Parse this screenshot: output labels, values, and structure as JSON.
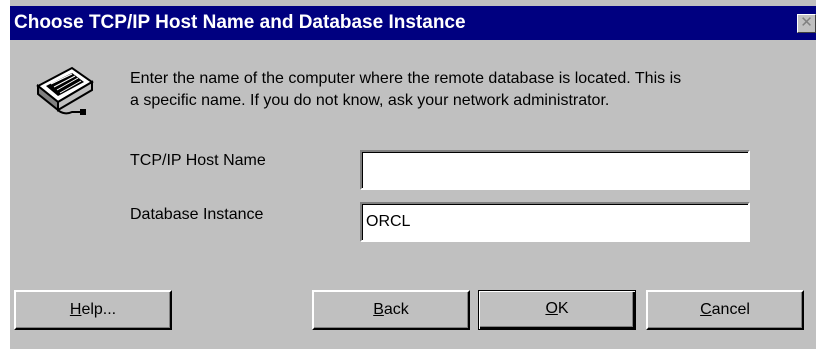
{
  "dialog": {
    "title": "Choose TCP/IP Host Name and Database Instance",
    "close_symbol": "✕",
    "icon": "network-computer-icon",
    "description_line1": "Enter the name of the computer where the remote database is located.  This is",
    "description_line2": "a specific name.  If you do not know, ask your network administrator."
  },
  "form": {
    "host_label": "TCP/IP Host Name",
    "host_value": "",
    "instance_label": "Database Instance",
    "instance_value": "ORCL"
  },
  "buttons": {
    "help": {
      "mnemonic": "H",
      "rest": "elp..."
    },
    "back": {
      "mnemonic": "B",
      "rest": "ack"
    },
    "ok": {
      "mnemonic": "O",
      "rest": "K"
    },
    "cancel": {
      "mnemonic": "C",
      "rest": "ancel"
    }
  }
}
